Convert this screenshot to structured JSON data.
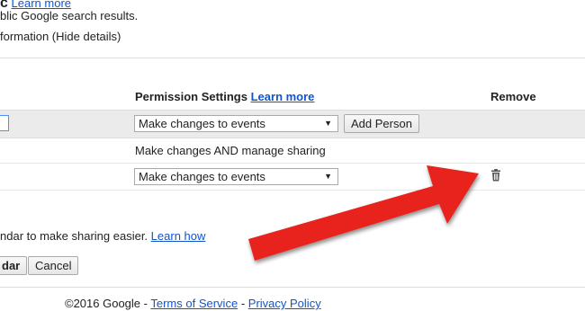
{
  "top": {
    "partial_char": "c",
    "learn_more": "Learn more",
    "line1": "blic Google search results.",
    "line2": "formation (Hide details)"
  },
  "table": {
    "permission_header": "Permission Settings",
    "permission_learn_more": "Learn more",
    "remove_header": "Remove",
    "new_person_permission": "Make changes to events",
    "add_person_label": "Add Person",
    "owner_permission": "Make changes AND manage sharing",
    "existing_permission": "Make changes to events"
  },
  "hint": {
    "text": "ndar to make sharing easier.",
    "link": "Learn how"
  },
  "buttons": {
    "save_partial": "dar",
    "cancel": "Cancel"
  },
  "footer": {
    "copyright": "©2016 Google -",
    "terms": "Terms of Service",
    "separator": "-",
    "privacy": "Privacy Policy"
  },
  "annotation": {
    "arrow_color": "#e8211f",
    "arrow_target": "trash-icon"
  },
  "colors": {
    "link": "#1155cc",
    "row_highlight": "#ebebeb",
    "input_focus": "#4d90fe"
  }
}
